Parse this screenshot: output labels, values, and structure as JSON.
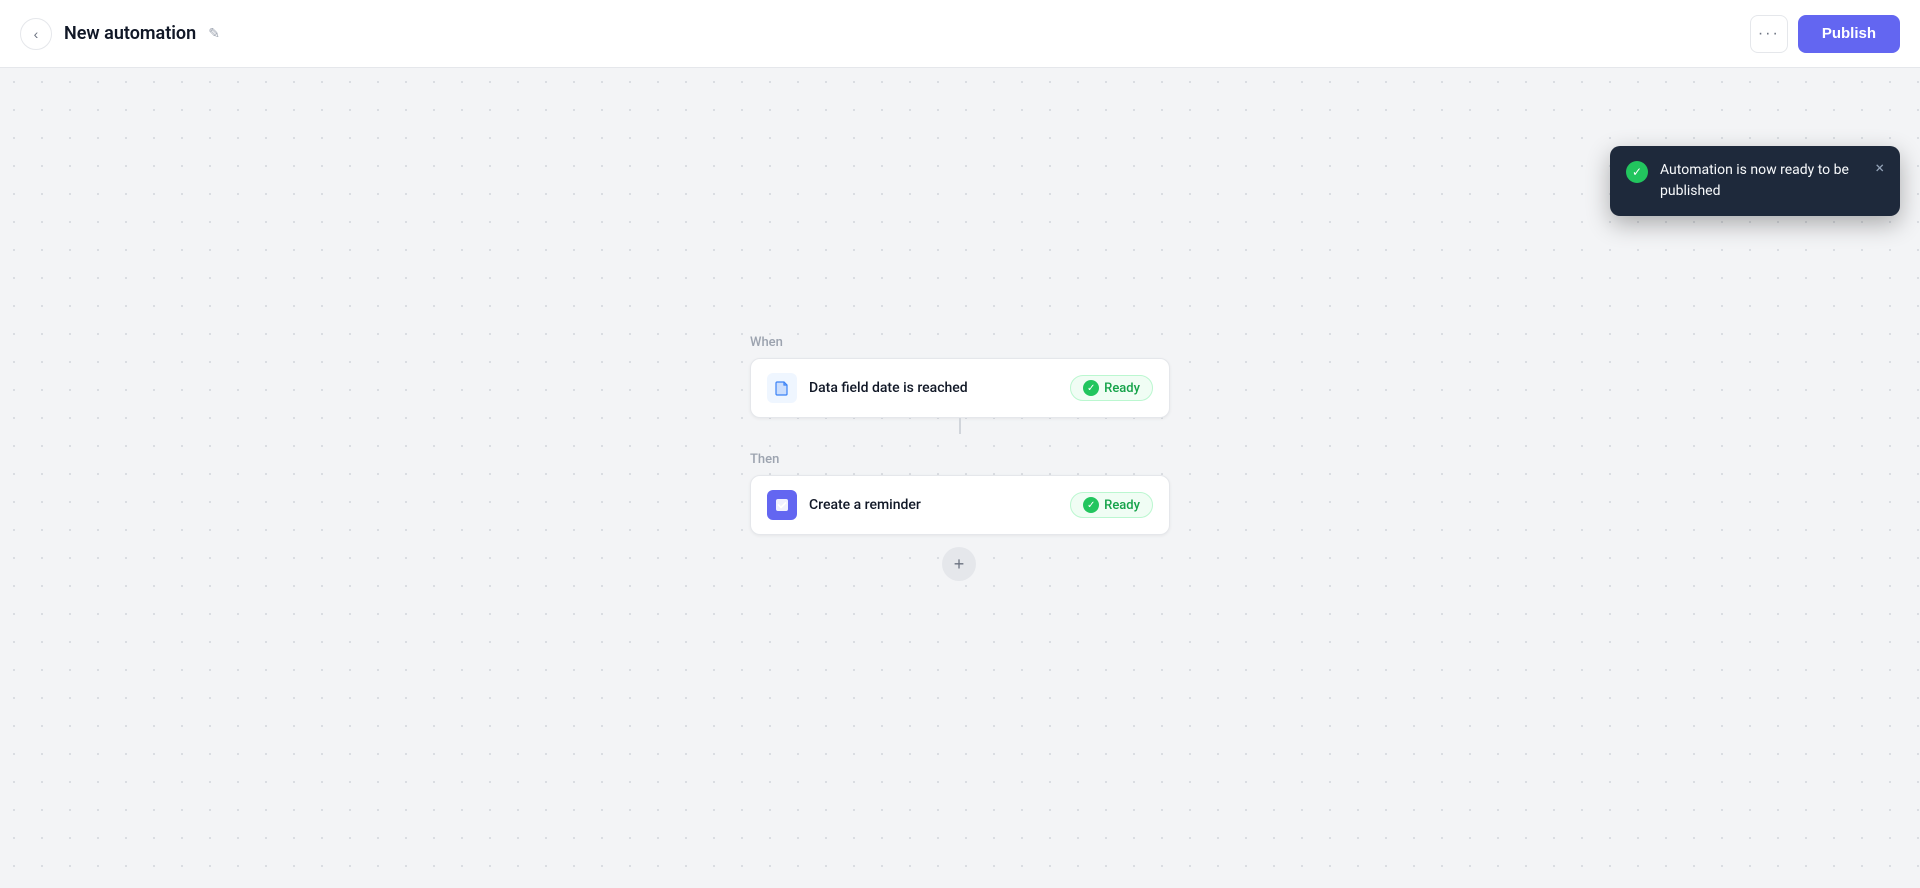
{
  "header": {
    "back_label": "‹",
    "title": "New automation",
    "edit_icon": "✎",
    "more_icon": "···",
    "publish_label": "Publish"
  },
  "canvas": {
    "when_label": "When",
    "then_label": "Then",
    "trigger": {
      "text": "Data field date is reached",
      "status": "Ready",
      "icon_type": "document"
    },
    "action": {
      "text": "Create a reminder",
      "status": "Ready",
      "icon_type": "checkbox"
    },
    "add_label": "+"
  },
  "toast": {
    "message": "Automation is now ready to be published",
    "close_icon": "×"
  }
}
